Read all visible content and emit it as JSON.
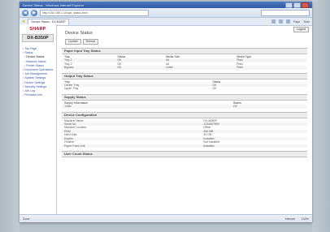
{
  "browser": {
    "title": "Device Status - Windows Internet Explorer",
    "address": "http://192.168.1.10/sys_status.html",
    "tab_label": "Device Status - DX-B350P",
    "toolbar_items": [
      "Page",
      "Tools"
    ],
    "status_left": "Done",
    "status_right": [
      "Internet",
      "100%"
    ]
  },
  "sidebar": {
    "brand": "SHARP",
    "model": "DX-B350P",
    "items": [
      {
        "label": "Top Page",
        "sub": false
      },
      {
        "label": "Status",
        "sub": false
      },
      {
        "label": "Device Status",
        "sub": true
      },
      {
        "label": "Network Status",
        "sub": true
      },
      {
        "label": "Printer Status",
        "sub": true
      },
      {
        "label": "Document Operations",
        "sub": false
      },
      {
        "label": "Job Management",
        "sub": false
      },
      {
        "label": "System Settings",
        "sub": false
      },
      {
        "label": "Device Settings",
        "sub": false
      },
      {
        "label": "Security Settings",
        "sub": false
      },
      {
        "label": "Job Log",
        "sub": false
      },
      {
        "label": "Firmware Info",
        "sub": false
      }
    ]
  },
  "main": {
    "title": "Device Status",
    "buttons": [
      "Update",
      "Reload"
    ],
    "top_right_button": "Logout",
    "paper_tray": {
      "heading": "Paper Input Tray Status",
      "columns": [
        "Tray",
        "Status",
        "Media Size",
        "Media Type"
      ],
      "rows": [
        [
          "Tray 1",
          "OK",
          "A4",
          "Plain"
        ],
        [
          "Tray 2",
          "OK",
          "A4",
          "Plain"
        ],
        [
          "Bypass",
          "OK",
          "Letter",
          "Plain"
        ]
      ]
    },
    "output_tray": {
      "heading": "Output Tray Status",
      "columns": [
        "Tray",
        "Status"
      ],
      "rows": [
        [
          "Center Tray",
          "OK"
        ],
        [
          "Upper Tray",
          "OK"
        ]
      ]
    },
    "supply": {
      "heading": "Supply Status",
      "columns": [
        "Supply Information",
        "Status"
      ],
      "rows": [
        [
          "Toner",
          "OK"
        ]
      ]
    },
    "device_config": {
      "heading": "Device Configuration",
      "rows": [
        [
          "Machine Name",
          "DX-B350P"
        ],
        [
          "Serial No.",
          "1234567890"
        ],
        [
          "Machine Location",
          "Office"
        ],
        [
          "RAM",
          "256 MB"
        ],
        [
          "Hard Disk",
          "40 GB"
        ],
        [
          "Duplex",
          "Installed"
        ],
        [
          "Finisher",
          "Not Installed"
        ],
        [
          "Paper Feed Unit",
          "Installed"
        ]
      ]
    },
    "user_count": {
      "heading": "User Count Status"
    }
  }
}
